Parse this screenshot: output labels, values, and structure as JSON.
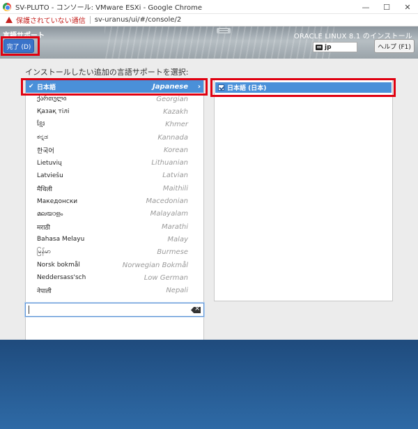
{
  "browser": {
    "window_title": "SV-PLUTO - コンソール: VMware ESXi - Google Chrome",
    "security_warning": "保護されていない通信",
    "url": "sv-uranus/ui/#/console/2",
    "minimize": "—",
    "maximize": "☐",
    "close": "✕"
  },
  "header": {
    "spoke_title": "言語サポート",
    "done_label": "完了 (D)",
    "product_title": "ORACLE LINUX 8.1 のインストール",
    "keyboard_layout": "jp",
    "help_label": "ヘルプ (F1)"
  },
  "main": {
    "prompt": "インストールしたい追加の言語サポートを選択:",
    "languages": [
      {
        "native": "日本語",
        "english": "Japanese",
        "selected": true
      },
      {
        "native": "ქართული",
        "english": "Georgian"
      },
      {
        "native": "Қазақ тілі",
        "english": "Kazakh"
      },
      {
        "native": "ខ្មែរ",
        "english": "Khmer"
      },
      {
        "native": "ಕನ್ನಡ",
        "english": "Kannada"
      },
      {
        "native": "한국어",
        "english": "Korean"
      },
      {
        "native": "Lietuvių",
        "english": "Lithuanian"
      },
      {
        "native": "Latviešu",
        "english": "Latvian"
      },
      {
        "native": "मैथिली",
        "english": "Maithili"
      },
      {
        "native": "Македонски",
        "english": "Macedonian"
      },
      {
        "native": "മലയാളം",
        "english": "Malayalam"
      },
      {
        "native": "मराठी",
        "english": "Marathi"
      },
      {
        "native": "Bahasa Melayu",
        "english": "Malay"
      },
      {
        "native": "မြန်မာ",
        "english": "Burmese"
      },
      {
        "native": "Norsk bokmål",
        "english": "Norwegian Bokmål"
      },
      {
        "native": "Neddersass'sch",
        "english": "Low German"
      },
      {
        "native": "नेपाली",
        "english": "Nepali"
      }
    ],
    "check_glyph": "✔",
    "arrow_glyph": "›",
    "locales": [
      {
        "label": "日本語 (日本)",
        "checked": true
      }
    ],
    "search": {
      "value": ""
    }
  },
  "colors": {
    "selection": "#4a90d9",
    "highlight": "#e00010",
    "done_button": "#3a73c9",
    "footer": "#2e6aa6"
  },
  "icons": {
    "browser": "chrome-icon",
    "warning": "warning-icon",
    "keyboard": "keyboard-icon",
    "check": "check-icon",
    "arrow": "chevron-right-icon",
    "clear": "backspace-clear-icon"
  }
}
